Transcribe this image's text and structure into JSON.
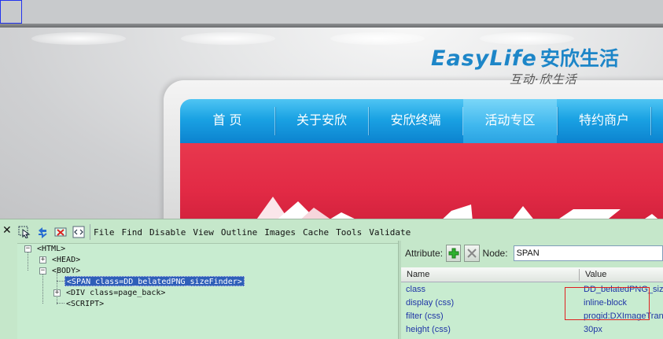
{
  "website": {
    "logo_en": "EasyLife",
    "logo_cn": "安欣生活",
    "slogan": "互动·欣生活",
    "nav": [
      {
        "label": "首 页",
        "active": false
      },
      {
        "label": "关于安欣",
        "active": false
      },
      {
        "label": "安欣终端",
        "active": false
      },
      {
        "label": "活动专区",
        "active": true
      },
      {
        "label": "特约商户",
        "active": false
      }
    ],
    "brand_color": "#1d86c8",
    "nav_color": "#1aa2e3",
    "banner_color": "#e22a45"
  },
  "devtools": {
    "close_icon": "close-icon",
    "toolbar_icons": [
      "select-element-icon",
      "refresh-icon",
      "clear-highlight-icon",
      "view-source-icon"
    ],
    "menu": [
      "File",
      "Find",
      "Disable",
      "View",
      "Outline",
      "Images",
      "Cache",
      "Tools",
      "Validate"
    ],
    "tree": [
      {
        "label": "<HTML>",
        "expander": "−"
      },
      {
        "label": "<HEAD>",
        "expander": "+"
      },
      {
        "label": "<BODY>",
        "expander": "−"
      },
      {
        "label": "<SPAN class=DD_belatedPNG_sizeFinder>",
        "selected": true
      },
      {
        "label": "<DIV class=page_back>",
        "expander": "+"
      },
      {
        "label": "<SCRIPT>"
      }
    ],
    "attributes": {
      "attribute_label": "Attribute:",
      "node_label": "Node:",
      "node_value": "SPAN",
      "columns": [
        "Name",
        "Value"
      ],
      "rows": [
        {
          "name": "class",
          "value": "DD_belatedPNG_sizeFinder"
        },
        {
          "name": "display (css)",
          "value": "inline-block"
        },
        {
          "name": "filter (css)",
          "value": "progid:DXImageTransform"
        },
        {
          "name": "height (css)",
          "value": "30px"
        }
      ]
    },
    "selection_color": "#2f5fb8",
    "panel_color": "#c5e7ca"
  }
}
